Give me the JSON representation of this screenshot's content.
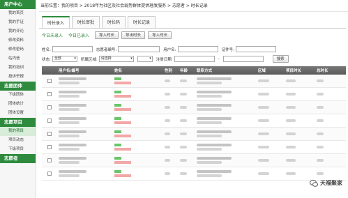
{
  "sidebar": {
    "sections": [
      {
        "title": "用户中心",
        "items": [
          "我的首页",
          "我的手证",
          "我的评论",
          "修改资料",
          "修改密码",
          "站内信",
          "我的培训",
          "投诉举报"
        ]
      },
      {
        "title": "志愿团体",
        "items": [
          "下级团体",
          "团体统计",
          "团体设置"
        ]
      },
      {
        "title": "志愿项目",
        "items": [
          "我的项目",
          "项目动态",
          "下级项目"
        ]
      },
      {
        "title": "志愿者",
        "items": []
      }
    ],
    "active_item": "我的项目"
  },
  "breadcrumb": "当前位置：我的项目 > 2018年为社区及社会弱势群体提供理发服务 > 志愿者 > 时长记录",
  "tabs": [
    "时长录入",
    "时长审批",
    "时长码",
    "时长记录"
  ],
  "actions": {
    "today_pending": "今日未录入",
    "today_done": "今日已录入",
    "import_btn": "导入时长",
    "export_btn": "导出时长",
    "import2_btn": "导入时长"
  },
  "filters": {
    "name_label": "姓名:",
    "volunteer_no_label": "志愿者编号:",
    "username_label": "用户名:",
    "id_label": "证件号:",
    "status_label": "状态:",
    "status_value": "全部",
    "region_label": "所属区域:",
    "region_value": "请选择",
    "regdate_label": "注册日期:",
    "date_sep": "-",
    "search_btn": "搜索"
  },
  "table": {
    "headers": [
      "用户名/编号",
      "姓名",
      "性别",
      "年龄",
      "联系方式",
      "区域",
      "项目时长",
      "总时长"
    ],
    "rows": 8
  },
  "watermark": "天福聚家"
}
